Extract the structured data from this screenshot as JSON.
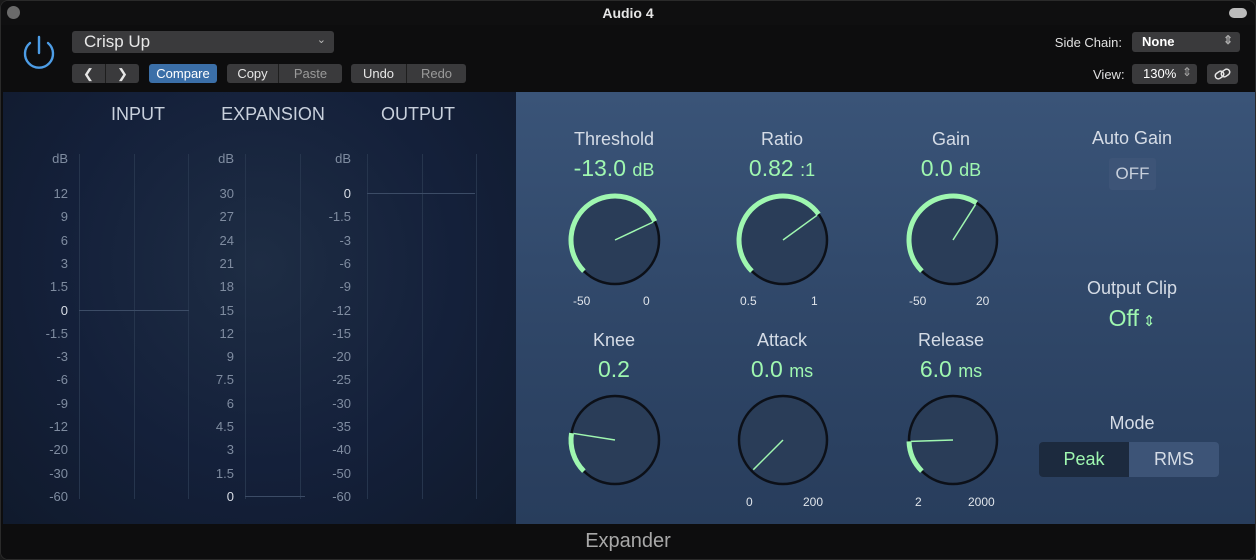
{
  "window": {
    "title": "Audio 4"
  },
  "toolbar": {
    "preset": "Crisp Up",
    "compare": "Compare",
    "copy": "Copy",
    "paste": "Paste",
    "undo": "Undo",
    "redo": "Redo",
    "side_chain_label": "Side Chain:",
    "side_chain_value": "None",
    "view_label": "View:",
    "view_value": "130%"
  },
  "meters": {
    "input": {
      "title": "INPUT",
      "unit": "dB",
      "scale": [
        "12",
        "9",
        "6",
        "3",
        "1.5",
        "0",
        "-1.5",
        "-3",
        "-6",
        "-9",
        "-12",
        "-20",
        "-30",
        "-60"
      ]
    },
    "expansion": {
      "title": "EXPANSION",
      "unit": "dB",
      "scale": [
        "30",
        "27",
        "24",
        "21",
        "18",
        "15",
        "12",
        "9",
        "7.5",
        "6",
        "4.5",
        "3",
        "1.5",
        "0"
      ]
    },
    "output": {
      "title": "OUTPUT",
      "unit": "dB",
      "scale": [
        "0",
        "-1.5",
        "-3",
        "-6",
        "-9",
        "-12",
        "-15",
        "-20",
        "-25",
        "-30",
        "-35",
        "-40",
        "-50",
        "-60"
      ]
    }
  },
  "knobs": {
    "threshold": {
      "label": "Threshold",
      "value": "-13.0",
      "unit": "dB",
      "min": "-50",
      "max": "0",
      "fraction": 0.74
    },
    "ratio": {
      "label": "Ratio",
      "value": "0.82",
      "unit": ":1",
      "min": "0.5",
      "max": "1",
      "fraction": 0.7
    },
    "gain": {
      "label": "Gain",
      "value": "0.0",
      "unit": "dB",
      "min": "-50",
      "max": "20",
      "fraction": 0.62
    },
    "knee": {
      "label": "Knee",
      "value": "0.2",
      "unit": "",
      "min": "",
      "max": "",
      "fraction": 0.2
    },
    "attack": {
      "label": "Attack",
      "value": "0.0",
      "unit": "ms",
      "min": "0",
      "max": "200",
      "fraction": 0.0
    },
    "release": {
      "label": "Release",
      "value": "6.0",
      "unit": "ms",
      "min": "2",
      "max": "2000",
      "fraction": 0.16
    }
  },
  "auto_gain": {
    "label": "Auto Gain",
    "value": "OFF"
  },
  "output_clip": {
    "label": "Output Clip",
    "value": "Off"
  },
  "mode": {
    "label": "Mode",
    "options": [
      "Peak",
      "RMS"
    ],
    "selected": "Peak"
  },
  "footer": {
    "name": "Expander"
  },
  "colors": {
    "accent": "#9ff7b0",
    "panel": "#34506f",
    "meter_bg": "#14203a",
    "compare_active": "#3b6fa8"
  }
}
